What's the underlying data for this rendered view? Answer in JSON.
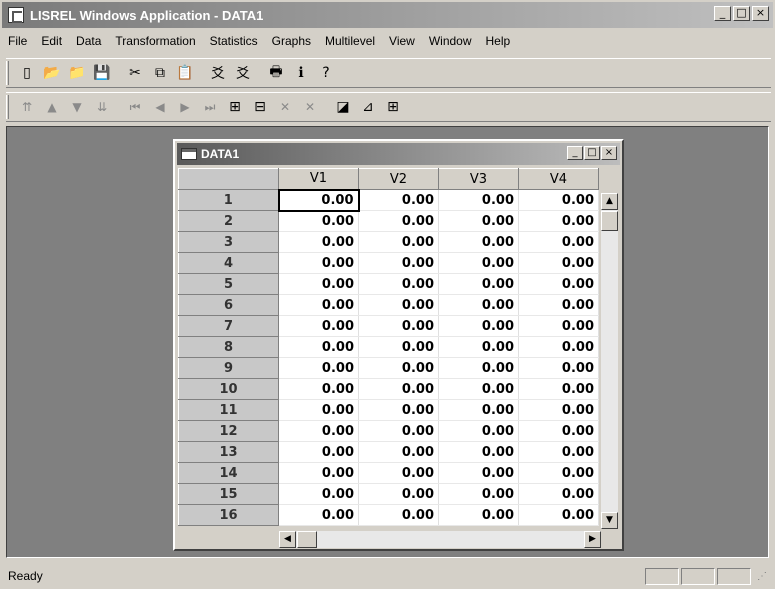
{
  "window": {
    "title": "LISREL Windows Application - DATA1",
    "controls": [
      "_",
      "□",
      "×"
    ]
  },
  "menu": [
    "File",
    "Edit",
    "Data",
    "Transformation",
    "Statistics",
    "Graphs",
    "Multilevel",
    "View",
    "Window",
    "Help"
  ],
  "toolbar1": [
    {
      "icon": "new-icon",
      "glyph": "▯"
    },
    {
      "icon": "open-icon",
      "glyph": "📂"
    },
    {
      "icon": "open-folder-icon",
      "glyph": "📁"
    },
    {
      "icon": "save-icon",
      "glyph": "💾"
    },
    {
      "icon": "cut-icon",
      "glyph": "✂"
    },
    {
      "icon": "copy-icon",
      "glyph": "⧉"
    },
    {
      "icon": "paste-icon",
      "glyph": "📋"
    },
    {
      "icon": "syntax-icon",
      "glyph": "爻"
    },
    {
      "icon": "syntax2-icon",
      "glyph": "爻"
    },
    {
      "icon": "print-icon",
      "glyph": "🖶"
    },
    {
      "icon": "info-icon",
      "glyph": "ℹ"
    },
    {
      "icon": "help-icon",
      "glyph": "?"
    }
  ],
  "toolbar2": [
    {
      "icon": "first-icon",
      "glyph": "⇈",
      "dim": true
    },
    {
      "icon": "up-icon",
      "glyph": "▲",
      "dim": true
    },
    {
      "icon": "down-icon",
      "glyph": "▼",
      "dim": true
    },
    {
      "icon": "last-icon",
      "glyph": "⇊",
      "dim": true
    },
    {
      "icon": "first-record-icon",
      "glyph": "⏮",
      "dim": true
    },
    {
      "icon": "prev-record-icon",
      "glyph": "◀",
      "dim": true
    },
    {
      "icon": "next-record-icon",
      "glyph": "▶",
      "dim": true
    },
    {
      "icon": "last-record-icon",
      "glyph": "⏭",
      "dim": true
    },
    {
      "icon": "insert-var-icon",
      "glyph": "⊞"
    },
    {
      "icon": "insert-case-icon",
      "glyph": "⊟"
    },
    {
      "icon": "delete-var-icon",
      "glyph": "✕",
      "dim": true
    },
    {
      "icon": "delete-case-icon",
      "glyph": "✕",
      "dim": true
    },
    {
      "icon": "graph-icon",
      "glyph": "◪"
    },
    {
      "icon": "chart-icon",
      "glyph": "⊿"
    },
    {
      "icon": "table-icon",
      "glyph": "⊞"
    }
  ],
  "child": {
    "title": "DATA1",
    "controls": [
      "_",
      "□",
      "×"
    ],
    "columns": [
      "V1",
      "V2",
      "V3",
      "V4"
    ],
    "rows": [
      {
        "label": "1",
        "values": [
          "0.00",
          "0.00",
          "0.00",
          "0.00"
        ]
      },
      {
        "label": "2",
        "values": [
          "0.00",
          "0.00",
          "0.00",
          "0.00"
        ]
      },
      {
        "label": "3",
        "values": [
          "0.00",
          "0.00",
          "0.00",
          "0.00"
        ]
      },
      {
        "label": "4",
        "values": [
          "0.00",
          "0.00",
          "0.00",
          "0.00"
        ]
      },
      {
        "label": "5",
        "values": [
          "0.00",
          "0.00",
          "0.00",
          "0.00"
        ]
      },
      {
        "label": "6",
        "values": [
          "0.00",
          "0.00",
          "0.00",
          "0.00"
        ]
      },
      {
        "label": "7",
        "values": [
          "0.00",
          "0.00",
          "0.00",
          "0.00"
        ]
      },
      {
        "label": "8",
        "values": [
          "0.00",
          "0.00",
          "0.00",
          "0.00"
        ]
      },
      {
        "label": "9",
        "values": [
          "0.00",
          "0.00",
          "0.00",
          "0.00"
        ]
      },
      {
        "label": "10",
        "values": [
          "0.00",
          "0.00",
          "0.00",
          "0.00"
        ]
      },
      {
        "label": "11",
        "values": [
          "0.00",
          "0.00",
          "0.00",
          "0.00"
        ]
      },
      {
        "label": "12",
        "values": [
          "0.00",
          "0.00",
          "0.00",
          "0.00"
        ]
      },
      {
        "label": "13",
        "values": [
          "0.00",
          "0.00",
          "0.00",
          "0.00"
        ]
      },
      {
        "label": "14",
        "values": [
          "0.00",
          "0.00",
          "0.00",
          "0.00"
        ]
      },
      {
        "label": "15",
        "values": [
          "0.00",
          "0.00",
          "0.00",
          "0.00"
        ]
      },
      {
        "label": "16",
        "values": [
          "0.00",
          "0.00",
          "0.00",
          "0.00"
        ]
      }
    ]
  },
  "status": {
    "text": "Ready"
  },
  "colors": {
    "mdi_background": "#808080",
    "face": "#d4d0c8",
    "title_gradient_start": "#7a7a7a"
  }
}
